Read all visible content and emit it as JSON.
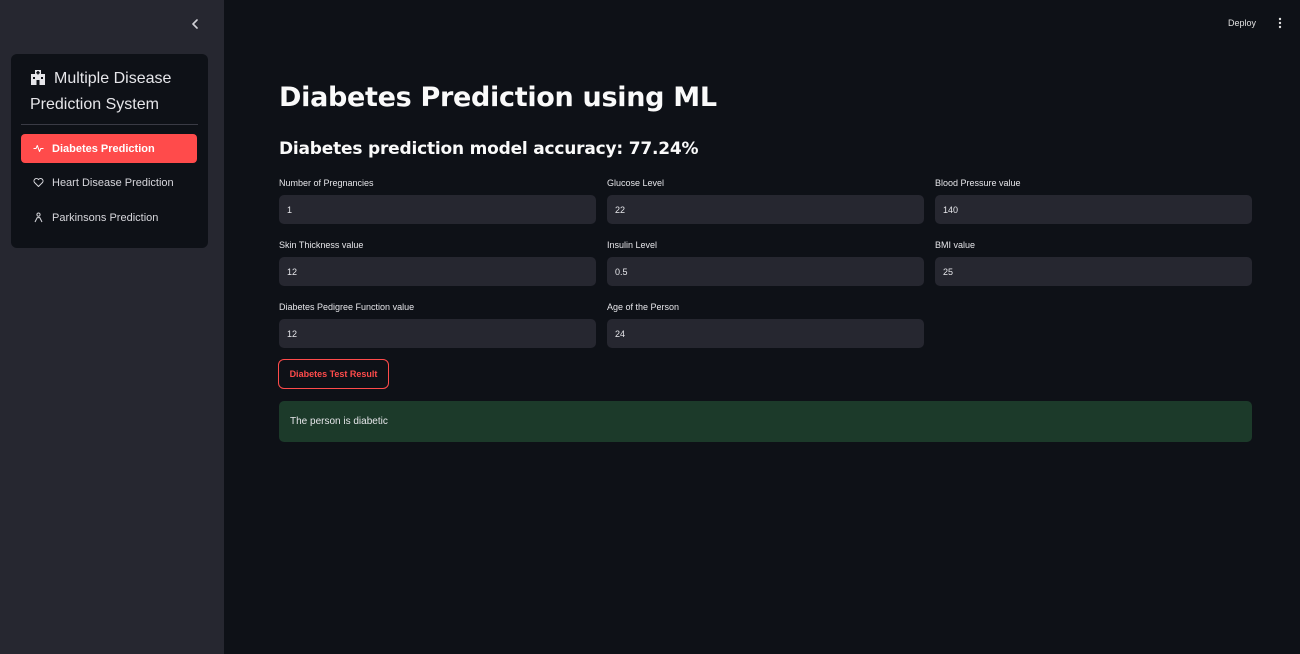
{
  "sidebar": {
    "collapse_icon": "chevron-left-icon",
    "menu": {
      "title": "Multiple Disease Prediction System",
      "title_icon": "hospital-icon",
      "items": [
        {
          "label": "Diabetes Prediction",
          "icon": "activity-icon",
          "active": true
        },
        {
          "label": "Heart Disease Prediction",
          "icon": "heart-icon",
          "active": false
        },
        {
          "label": "Parkinsons Prediction",
          "icon": "person-icon",
          "active": false
        }
      ]
    }
  },
  "header": {
    "deploy_label": "Deploy",
    "menu_icon": "kebab-menu-icon"
  },
  "main": {
    "title": "Diabetes Prediction using ML",
    "accuracy_text": "Diabetes prediction model accuracy: 77.24%",
    "fields": [
      {
        "label": "Number of Pregnancies",
        "value": "1"
      },
      {
        "label": "Glucose Level",
        "value": "22"
      },
      {
        "label": "Blood Pressure value",
        "value": "140"
      },
      {
        "label": "Skin Thickness value",
        "value": "12"
      },
      {
        "label": "Insulin Level",
        "value": "0.5"
      },
      {
        "label": "BMI value",
        "value": "25"
      },
      {
        "label": "Diabetes Pedigree Function value",
        "value": "12"
      },
      {
        "label": "Age of the Person",
        "value": "24"
      }
    ],
    "submit_label": "Diabetes Test Result",
    "result_text": "The person is diabetic"
  },
  "colors": {
    "accent": "#ff4b4b",
    "background": "#0e1117",
    "sidebar_bg": "#262730",
    "success_bg": "#1c3a2a"
  }
}
